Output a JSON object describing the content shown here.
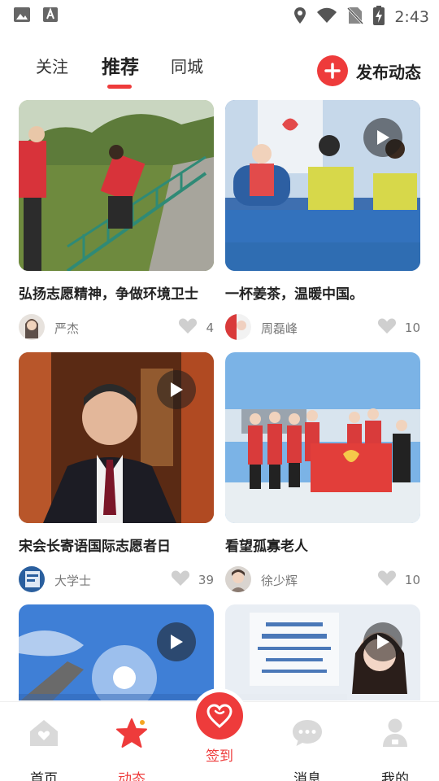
{
  "status_bar": {
    "time": "2:43"
  },
  "tabs": [
    {
      "label": "关注",
      "active": false
    },
    {
      "label": "推荐",
      "active": true
    },
    {
      "label": "同城",
      "active": false
    }
  ],
  "publish": {
    "label": "发布动态"
  },
  "feed": [
    {
      "title": "弘扬志愿精神，争做环境卫士",
      "author": "严杰",
      "likes": "4",
      "video": false
    },
    {
      "title": "一杯姜茶，温暖中国。",
      "author": "周磊峰",
      "likes": "10",
      "video": true
    },
    {
      "title": "宋会长寄语国际志愿者日",
      "author": "大学士",
      "likes": "39",
      "video": true
    },
    {
      "title": "看望孤寡老人",
      "author": "徐少辉",
      "likes": "10",
      "video": false
    },
    {
      "title": "",
      "author": "",
      "likes": "",
      "video": true
    },
    {
      "title": "",
      "author": "",
      "likes": "",
      "video": true
    }
  ],
  "bottom_nav": [
    {
      "label": "首页",
      "icon": "home-icon",
      "active": false
    },
    {
      "label": "动态",
      "icon": "star-icon",
      "active": true
    },
    {
      "label": "签到",
      "icon": "checkin-heart-icon",
      "active": false
    },
    {
      "label": "消息",
      "icon": "message-icon",
      "active": false
    },
    {
      "label": "我的",
      "icon": "profile-icon",
      "active": false
    }
  ],
  "colors": {
    "accent": "#ee3b3b",
    "inactive_icon": "#d6d6d6"
  }
}
